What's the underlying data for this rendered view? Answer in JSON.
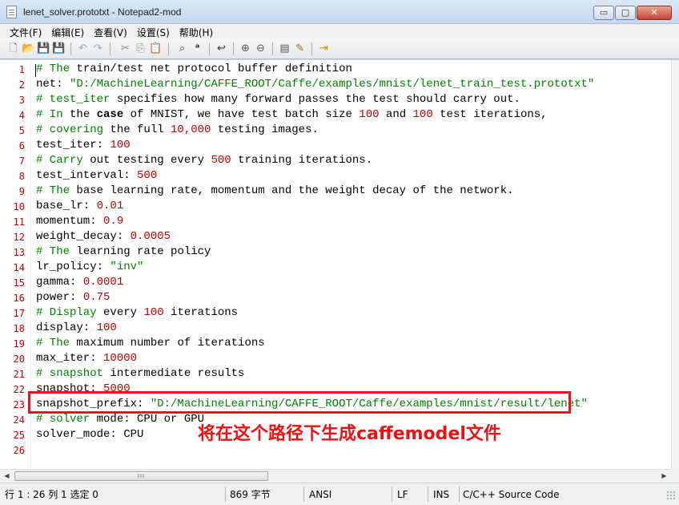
{
  "window": {
    "title": "lenet_solver.prototxt - Notepad2-mod",
    "min_glyph": "▭",
    "max_glyph": "▢",
    "close_glyph": "✕"
  },
  "menu": [
    "文件(F)",
    "编辑(E)",
    "查看(V)",
    "设置(S)",
    "帮助(H)"
  ],
  "toolbar": {
    "icons": [
      "new-file-icon",
      "open-folder-icon",
      "browse-icon",
      "save-icon",
      "undo-icon",
      "redo-icon",
      "cut-icon",
      "copy-icon",
      "paste-icon",
      "find-icon",
      "replace-icon",
      "word-wrap-icon",
      "zoom-in-icon",
      "zoom-out-icon",
      "schemes-icon",
      "customize-icon",
      "exit-icon"
    ],
    "glyphs": [
      "🗋",
      "📂",
      "💾",
      "💾",
      "↶",
      "↷",
      "✂",
      "⎘",
      "📋",
      "⌕",
      "ᵃ",
      "↩",
      "⊕",
      "⊖",
      "▤",
      "✎",
      "⇥"
    ]
  },
  "editor": {
    "lines": [
      {
        "n": "1",
        "parts": [
          [
            "cmt",
            "# The"
          ],
          [
            "k",
            " train/test net protocol buffer definition"
          ]
        ]
      },
      {
        "n": "2",
        "parts": [
          [
            "k",
            "net: "
          ],
          [
            "s",
            "\"D:/MachineLearning/CAFFE_ROOT/Caffe/examples/mnist/lenet_train_test.prototxt\""
          ]
        ]
      },
      {
        "n": "3",
        "parts": [
          [
            "cmt",
            "# test_iter"
          ],
          [
            "k",
            " specifies how many forward passes the test should carry out."
          ]
        ]
      },
      {
        "n": "4",
        "parts": [
          [
            "cmt",
            "# In"
          ],
          [
            "k",
            " the "
          ],
          [
            "b",
            "case"
          ],
          [
            "k",
            " of MNIST, we have test batch size "
          ],
          [
            "v",
            "100"
          ],
          [
            "k",
            " and "
          ],
          [
            "v",
            "100"
          ],
          [
            "k",
            " test iterations,"
          ]
        ]
      },
      {
        "n": "5",
        "parts": [
          [
            "cmt",
            "# covering"
          ],
          [
            "k",
            " the full "
          ],
          [
            "v",
            "10,000"
          ],
          [
            "k",
            " testing images."
          ]
        ]
      },
      {
        "n": "6",
        "parts": [
          [
            "k",
            "test_iter: "
          ],
          [
            "v",
            "100"
          ]
        ]
      },
      {
        "n": "7",
        "parts": [
          [
            "cmt",
            "# Carry"
          ],
          [
            "k",
            " out testing every "
          ],
          [
            "v",
            "500"
          ],
          [
            "k",
            " training iterations."
          ]
        ]
      },
      {
        "n": "8",
        "parts": [
          [
            "k",
            "test_interval: "
          ],
          [
            "v",
            "500"
          ]
        ]
      },
      {
        "n": "9",
        "parts": [
          [
            "cmt",
            "# The"
          ],
          [
            "k",
            " base learning rate, momentum and the weight decay of the network."
          ]
        ]
      },
      {
        "n": "10",
        "parts": [
          [
            "k",
            "base_lr: "
          ],
          [
            "v",
            "0.01"
          ]
        ]
      },
      {
        "n": "11",
        "parts": [
          [
            "k",
            "momentum: "
          ],
          [
            "v",
            "0.9"
          ]
        ]
      },
      {
        "n": "12",
        "parts": [
          [
            "k",
            "weight_decay: "
          ],
          [
            "v",
            "0.0005"
          ]
        ]
      },
      {
        "n": "13",
        "parts": [
          [
            "cmt",
            "# The"
          ],
          [
            "k",
            " learning rate policy"
          ]
        ]
      },
      {
        "n": "14",
        "parts": [
          [
            "k",
            "lr_policy: "
          ],
          [
            "s",
            "\"inv\""
          ]
        ]
      },
      {
        "n": "15",
        "parts": [
          [
            "k",
            "gamma: "
          ],
          [
            "v",
            "0.0001"
          ]
        ]
      },
      {
        "n": "16",
        "parts": [
          [
            "k",
            "power: "
          ],
          [
            "v",
            "0.75"
          ]
        ]
      },
      {
        "n": "17",
        "parts": [
          [
            "cmt",
            "# Display"
          ],
          [
            "k",
            " every "
          ],
          [
            "v",
            "100"
          ],
          [
            "k",
            " iterations"
          ]
        ]
      },
      {
        "n": "18",
        "parts": [
          [
            "k",
            "display: "
          ],
          [
            "v",
            "100"
          ]
        ]
      },
      {
        "n": "19",
        "parts": [
          [
            "cmt",
            "# The"
          ],
          [
            "k",
            " maximum number of iterations"
          ]
        ]
      },
      {
        "n": "20",
        "parts": [
          [
            "k",
            "max_iter: "
          ],
          [
            "v",
            "10000"
          ]
        ]
      },
      {
        "n": "21",
        "parts": [
          [
            "cmt",
            "# snapshot"
          ],
          [
            "k",
            " intermediate results"
          ]
        ]
      },
      {
        "n": "22",
        "parts": [
          [
            "k",
            "snapshot: "
          ],
          [
            "v",
            "5000"
          ]
        ]
      },
      {
        "n": "23",
        "parts": [
          [
            "k",
            "snapshot_prefix: "
          ],
          [
            "s",
            "\"D:/MachineLearning/CAFFE_ROOT/Caffe/examples/mnist/result/lenet\""
          ]
        ]
      },
      {
        "n": "24",
        "parts": [
          [
            "cmt",
            "# solver"
          ],
          [
            "k",
            " mode: CPU or GPU"
          ]
        ]
      },
      {
        "n": "25",
        "parts": [
          [
            "k",
            "solver_mode: CPU"
          ]
        ]
      },
      {
        "n": "26",
        "parts": []
      }
    ],
    "annotation": "将在这个路径下生成caffemodel文件"
  },
  "scrollbar": {
    "left_arrow": "◀",
    "right_arrow": "▶",
    "thumb_grip": "III"
  },
  "status": {
    "position": "行 1 : 26   列 1   选定 0",
    "size": "869 字节",
    "encoding": "ANSI",
    "eol": "LF",
    "ins": "INS",
    "lexer": "C/C++ Source Code"
  }
}
